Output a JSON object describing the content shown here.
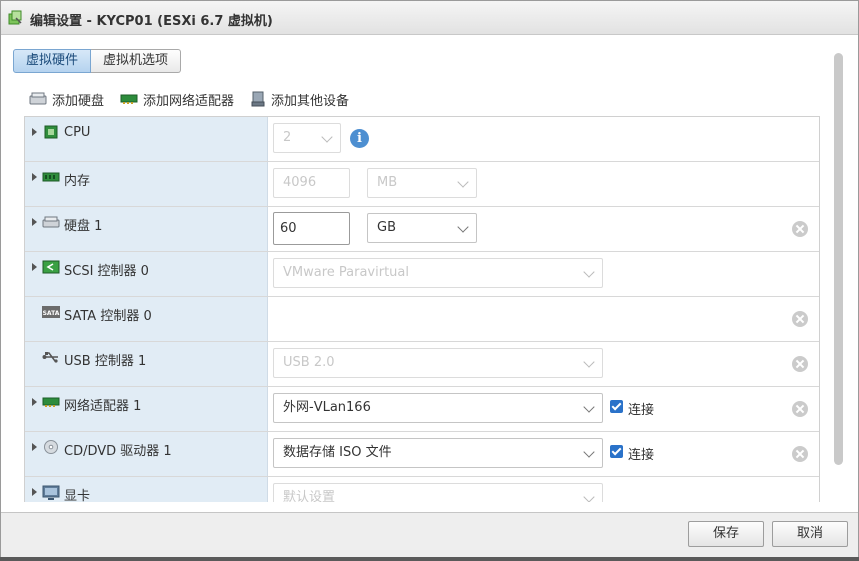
{
  "window": {
    "title": "编辑设置 - KYCP01 (ESXi 6.7 虚拟机)"
  },
  "tabs": [
    {
      "label": "虚拟硬件",
      "active": true
    },
    {
      "label": "虚拟机选项",
      "active": false
    }
  ],
  "toolbar": {
    "add_disk": "添加硬盘",
    "add_nic": "添加网络适配器",
    "add_other": "添加其他设备"
  },
  "devices": {
    "cpu": {
      "label": "CPU",
      "value": "2",
      "icon": "cpu-icon"
    },
    "memory": {
      "label": "内存",
      "value": "4096",
      "unit": "MB",
      "icon": "memory-icon"
    },
    "disk": {
      "label": "硬盘 1",
      "value": "60",
      "unit": "GB",
      "icon": "harddisk-icon"
    },
    "scsi": {
      "label": "SCSI 控制器 0",
      "value": "VMware Paravirtual",
      "icon": "scsi-icon"
    },
    "sata": {
      "label": "SATA 控制器 0",
      "icon": "sata-icon",
      "icon_text": "SATA"
    },
    "usb": {
      "label": "USB 控制器 1",
      "value": "USB 2.0",
      "icon": "usb-icon"
    },
    "nic": {
      "label": "网络适配器 1",
      "value": "外网-VLan166",
      "connect_label": "连接",
      "connected": true,
      "icon": "network-adapter-icon"
    },
    "cdrom": {
      "label": "CD/DVD 驱动器 1",
      "value": "数据存储 ISO 文件",
      "connect_label": "连接",
      "connected": true,
      "icon": "cdrom-icon"
    },
    "video": {
      "label": "显卡",
      "value": "默认设置",
      "icon": "monitor-icon"
    }
  },
  "footer": {
    "save": "保存",
    "cancel": "取消"
  },
  "colors": {
    "label_bg": "#e1ecf5",
    "accent": "#2a72c9",
    "info": "#4d8fd1"
  }
}
